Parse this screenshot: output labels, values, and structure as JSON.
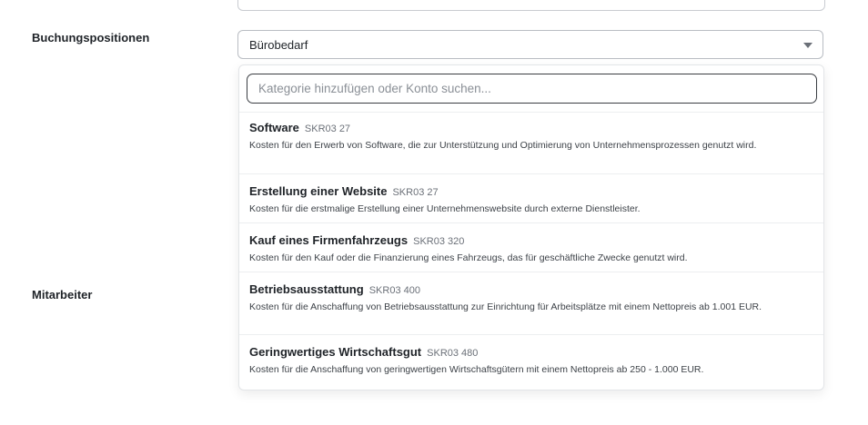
{
  "form": {
    "booking_label": "Buchungspositionen",
    "employee_label": "Mitarbeiter",
    "selected_category": "Bürobedarf"
  },
  "dropdown": {
    "search_placeholder": "Kategorie hinzufügen oder Konto suchen...",
    "options": [
      {
        "name": "Software",
        "code": "SKR03 27",
        "description": "Kosten für den Erwerb von Software, die zur Unterstützung und Optimierung von Unternehmensprozessen genutzt wird."
      },
      {
        "name": "Erstellung einer Website",
        "code": "SKR03 27",
        "description": "Kosten für die erstmalige Erstellung einer Unternehmenswebsite durch externe Dienstleister."
      },
      {
        "name": "Kauf eines Firmenfahrzeugs",
        "code": "SKR03 320",
        "description": "Kosten für den Kauf oder die Finanzierung eines Fahrzeugs, das für geschäftliche Zwecke genutzt wird."
      },
      {
        "name": "Betriebsausstattung",
        "code": "SKR03 400",
        "description": "Kosten für die Anschaffung von Betriebsausstattung zur Einrichtung für Arbeitsplätze mit einem Nettopreis ab 1.001 EUR."
      },
      {
        "name": "Geringwertiges Wirtschaftsgut",
        "code": "SKR03 480",
        "description": "Kosten für die Anschaffung von geringwertigen Wirtschaftsgütern mit einem Nettopreis ab 250 - 1.000 EUR."
      }
    ]
  }
}
